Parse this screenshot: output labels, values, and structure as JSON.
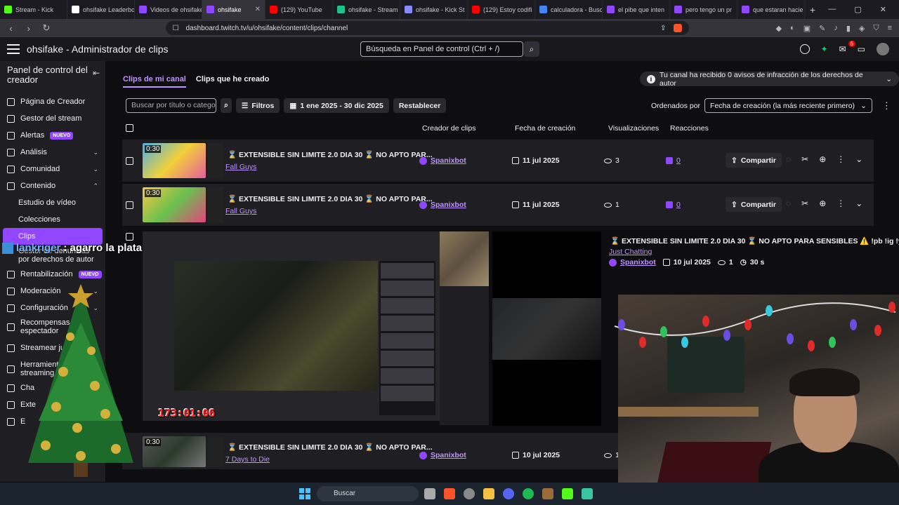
{
  "browser": {
    "tabs": [
      {
        "label": "Stream - Kick",
        "color": "#53fc18"
      },
      {
        "label": "ohsifake Leaderbo",
        "color": "#ffffff"
      },
      {
        "label": "Videos de ohsifake",
        "color": "#9147ff"
      },
      {
        "label": "ohsifake",
        "color": "#9147ff"
      },
      {
        "label": "(129) YouTube",
        "color": "#ff0000"
      },
      {
        "label": "ohsifake - Stream",
        "color": "#1ec28b"
      },
      {
        "label": "ohsifake - Kick St",
        "color": "#8a8aff"
      },
      {
        "label": "(129) Estoy codifi",
        "color": "#ff0000"
      },
      {
        "label": "calculadora - Busc",
        "color": "#4285f4"
      },
      {
        "label": "el pibe que inten",
        "color": "#9147ff"
      },
      {
        "label": "pero tengo un pr",
        "color": "#9147ff"
      },
      {
        "label": "que estaran hacie",
        "color": "#9147ff"
      }
    ],
    "url": "dashboard.twitch.tv/u/ohsifake/content/clips/channel"
  },
  "topnav": {
    "title": "ohsifake - Administrador de clips",
    "search_placeholder": "Búsqueda en Panel de control (Ctrl + /)",
    "notif_count": "6"
  },
  "sidebar": {
    "header": "Panel de control del creador",
    "items": [
      {
        "label": "Página de Creador",
        "icon": "home-icon"
      },
      {
        "label": "Gestor del stream",
        "icon": "broadcast-icon"
      },
      {
        "label": "Alertas",
        "icon": "megaphone-icon",
        "badge": "NUEVO"
      },
      {
        "label": "Análisis",
        "icon": "chart-icon"
      },
      {
        "label": "Comunidad",
        "icon": "users-icon"
      },
      {
        "label": "Contenido",
        "icon": "content-icon"
      }
    ],
    "content_subitems": [
      "Estudio de vídeo",
      "Colecciones",
      "Clips",
      "Gestor de denuncias por derechos de autor"
    ],
    "more_items": [
      {
        "label": "Rentabilización",
        "badge": "NUEVO"
      },
      {
        "label": "Moderación"
      },
      {
        "label": "Configuración"
      },
      {
        "label": "Recompensas del espectador"
      },
      {
        "label": "Streamear juntos"
      },
      {
        "label": "Herramientas de streaming"
      },
      {
        "label": "Cha"
      },
      {
        "label": "Exte"
      },
      {
        "label": "E"
      }
    ]
  },
  "main": {
    "tab_mine": "Clips de mi canal",
    "tab_created": "Clips que he creado",
    "notice": "Tu canal ha recibido 0 avisos de infracción de los derechos de autor",
    "search_placeholder": "Buscar por título o categoría",
    "filters_label": "Filtros",
    "date_range": "1 ene 2025 - 30 dic 2025",
    "reset_label": "Restablecer",
    "sorted_by": "Ordenados por",
    "sort_value": "Fecha de creación (la más reciente primero)",
    "columns": {
      "creator": "Creador de clips",
      "date": "Fecha de creación",
      "views": "Visualizaciones",
      "reactions": "Reacciones"
    },
    "share_label": "Compartir",
    "clips": [
      {
        "duration": "0:30",
        "title": "⌛ EXTENSIBLE SIN LIMITE 2.0 DIA 30 ⌛ NO APTO PAR...",
        "game": "Fall Guys",
        "creator": "Spanixbot",
        "date": "11 jul 2025",
        "views": "3",
        "reactions": "0"
      },
      {
        "duration": "0:30",
        "title": "⌛ EXTENSIBLE SIN LIMITE 2.0 DIA 30 ⌛ NO APTO PAR...",
        "game": "Fall Guys",
        "creator": "Spanixbot",
        "date": "11 jul 2025",
        "views": "1",
        "reactions": "0"
      },
      {
        "title": "⌛ EXTENSIBLE SIN LIMITE 2.0 DIA 30 ⌛ NO APTO PARA SENSIBLES ⚠️ !pb !ig !yt !te",
        "game": "Just Chatting",
        "creator": "Spanixbot",
        "date": "10 jul 2025",
        "views": "1",
        "length": "30 s"
      },
      {
        "duration": "0:30",
        "title": "⌛ EXTENSIBLE SIN LIMITE 2.0 DIA 30 ⌛ NO APTO PAR...",
        "game": "7 Days to Die",
        "creator": "Spanixbot",
        "date": "10 jul 2025",
        "views": "1"
      }
    ]
  },
  "overlay": {
    "chat_user": "lankriger",
    "chat_msg": ": agarro la plata",
    "timer": "173:01:06"
  },
  "taskbar": {
    "search_label": "Buscar"
  }
}
